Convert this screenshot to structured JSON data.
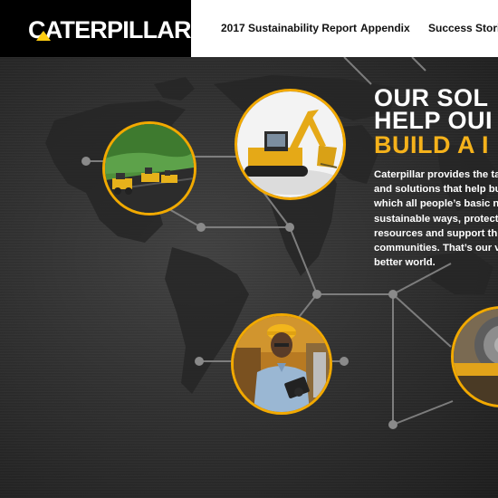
{
  "header": {
    "logo_text": "CATERPILLAR",
    "logo_mark": "®",
    "nav": [
      "2017 Sustainability Report",
      "Appendix",
      "Success Stories"
    ]
  },
  "hero": {
    "heading_lines": [
      "OUR SOL",
      "HELP OUI",
      "BUILD A I"
    ],
    "paragraph_lines": [
      "Caterpillar provides the talen",
      "and solutions that help build",
      "which all people’s basic need",
      "sustainable ways, protect ou",
      "resources and support thrivi",
      "communities. That’s our visio",
      "better world."
    ]
  },
  "colors": {
    "brand_yellow": "#ffcd11",
    "accent_orange": "#f2a900",
    "header_black": "#000000",
    "background_dark": "#2a2a2a"
  },
  "images": [
    "paving-machines-photo",
    "excavator-photo",
    "worker-with-tablet-photo",
    "factory-machinery-photo"
  ]
}
